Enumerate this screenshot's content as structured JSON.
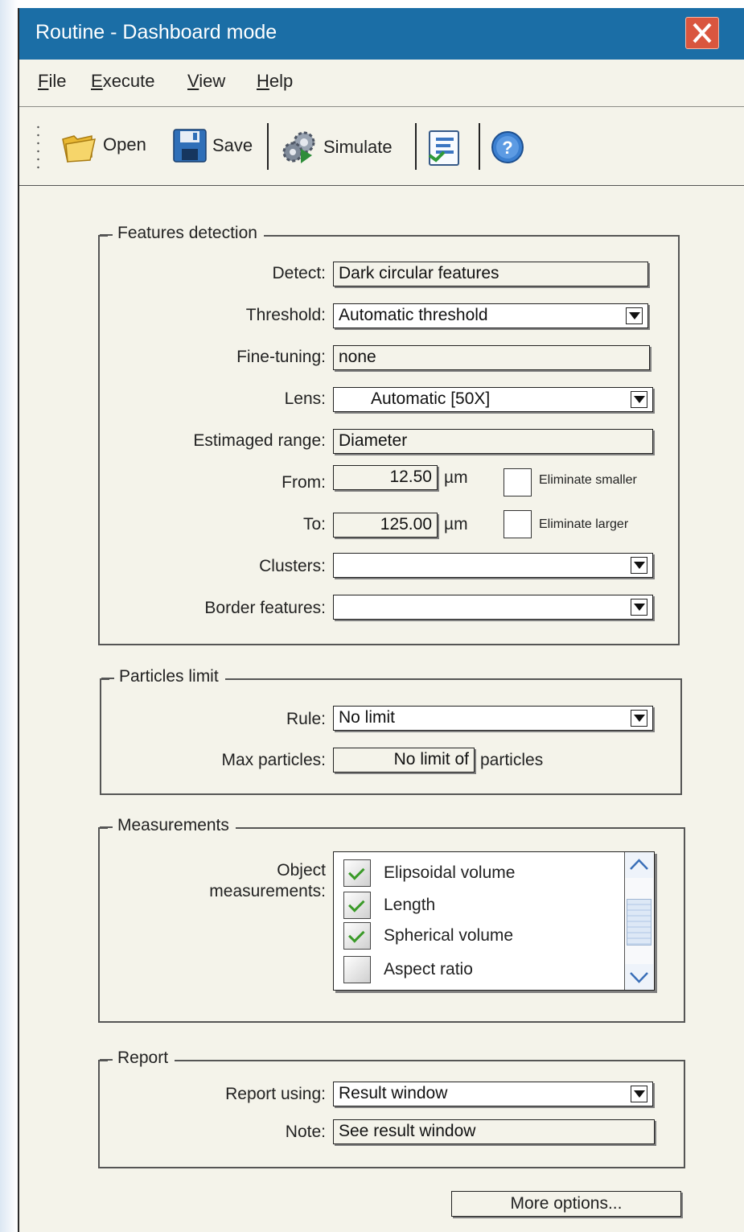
{
  "window": {
    "title": "Routine - Dashboard mode"
  },
  "menu": [
    {
      "label": "File"
    },
    {
      "label": "Execute"
    },
    {
      "label": "View"
    },
    {
      "label": "Help"
    }
  ],
  "toolbar": {
    "open_label": "Open",
    "save_label": "Save",
    "simulate_label": "Simulate",
    "icons": [
      "folder-icon",
      "floppy-disk-icon",
      "gears-icon",
      "checklist-icon",
      "help-icon"
    ]
  },
  "features": {
    "legend": "Features detection",
    "detect_label": "Detect:",
    "detect_value": "Dark circular features",
    "threshold_label": "Threshold:",
    "threshold_value": "Automatic threshold",
    "finetuning_label": "Fine-tuning:",
    "finetuning_value": "none",
    "lens_label": "Lens:",
    "lens_value": "Automatic [50X]",
    "range_label": "Estimaged range:",
    "range_value": "Diameter",
    "from_label": "From:",
    "from_value": "12.50",
    "to_label": "To:",
    "to_value": "125.00",
    "unit": "µm",
    "eliminate_smaller": "Eliminate smaller",
    "eliminate_larger": "Eliminate larger",
    "clusters_label": "Clusters:",
    "clusters_value": "",
    "border_label": "Border features:",
    "border_value": ""
  },
  "particles": {
    "legend": "Particles limit",
    "rule_label": "Rule:",
    "rule_value": "No limit",
    "max_label": "Max particles:",
    "max_value": "No limit of",
    "max_suffix": "particles"
  },
  "measurements": {
    "legend": "Measurements",
    "object_label_1": "Object",
    "object_label_2": "measurements:",
    "items": [
      {
        "label": "Elipsoidal volume",
        "checked": true
      },
      {
        "label": "Length",
        "checked": true
      },
      {
        "label": "Spherical volume",
        "checked": true
      },
      {
        "label": "Aspect ratio",
        "checked": false
      }
    ]
  },
  "report": {
    "legend": "Report",
    "using_label": "Report using:",
    "using_value": "Result window",
    "note_label": "Note:",
    "note_value": "See result window"
  },
  "more_options": "More options...",
  "colors": {
    "titlebar": "#1b6ea6",
    "panel": "#f4f3ea",
    "close": "#d9563f",
    "check": "#3a9a28"
  }
}
